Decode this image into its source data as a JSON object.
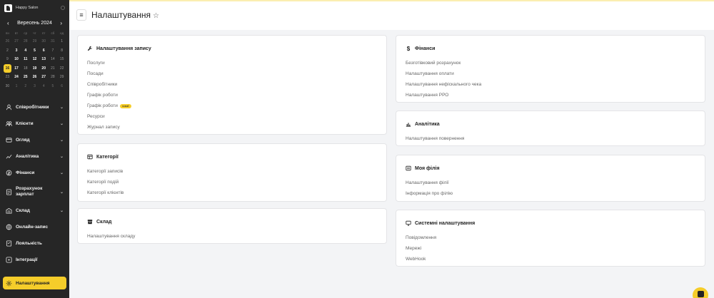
{
  "app": {
    "name": "Happy Salon"
  },
  "calendar": {
    "month": "Вересень 2024",
    "weekdays": [
      "пн",
      "вт",
      "ср",
      "чт",
      "пт",
      "сб",
      "нд"
    ],
    "rows": [
      [
        {
          "d": "26",
          "m": 1
        },
        {
          "d": "27",
          "m": 1
        },
        {
          "d": "28",
          "m": 1
        },
        {
          "d": "29",
          "m": 1
        },
        {
          "d": "30",
          "m": 1
        },
        {
          "d": "31",
          "m": 1
        },
        {
          "d": "1",
          "w": 1
        }
      ],
      [
        {
          "d": "2",
          "w": 1
        },
        {
          "d": "3"
        },
        {
          "d": "4"
        },
        {
          "d": "5"
        },
        {
          "d": "6"
        },
        {
          "d": "7",
          "w": 1
        },
        {
          "d": "8",
          "w": 1
        }
      ],
      [
        {
          "d": "9",
          "w": 1
        },
        {
          "d": "10"
        },
        {
          "d": "11"
        },
        {
          "d": "12"
        },
        {
          "d": "13"
        },
        {
          "d": "14",
          "w": 1
        },
        {
          "d": "15",
          "w": 1
        }
      ],
      [
        {
          "d": "16",
          "t": 1
        },
        {
          "d": "17"
        },
        {
          "d": "18",
          "w": 1
        },
        {
          "d": "19"
        },
        {
          "d": "20"
        },
        {
          "d": "21",
          "w": 1
        },
        {
          "d": "22",
          "w": 1
        }
      ],
      [
        {
          "d": "23",
          "w": 1
        },
        {
          "d": "24"
        },
        {
          "d": "25"
        },
        {
          "d": "26"
        },
        {
          "d": "27"
        },
        {
          "d": "28",
          "w": 1
        },
        {
          "d": "29",
          "w": 1
        }
      ],
      [
        {
          "d": "30",
          "w": 1
        },
        {
          "d": "1",
          "m": 1
        },
        {
          "d": "2",
          "m": 1
        },
        {
          "d": "3",
          "m": 1
        },
        {
          "d": "4",
          "m": 1
        },
        {
          "d": "5",
          "m": 1
        },
        {
          "d": "6",
          "m": 1
        }
      ]
    ]
  },
  "sidebar": {
    "items": [
      {
        "label": "Співробітники",
        "icon": "users-icon"
      },
      {
        "label": "Клієнти",
        "icon": "clients-icon"
      },
      {
        "label": "Огляд",
        "icon": "overview-icon"
      },
      {
        "label": "Аналітика",
        "icon": "analytics-icon"
      },
      {
        "label": "Фінанси",
        "icon": "finance-icon"
      },
      {
        "label": "Розрахунок зарплат",
        "icon": "payroll-icon"
      },
      {
        "label": "Склад",
        "icon": "warehouse-icon"
      },
      {
        "label": "Онлайн-запис",
        "icon": "online-booking-icon"
      },
      {
        "label": "Лояльність",
        "icon": "loyalty-icon"
      },
      {
        "label": "Інтеграції",
        "icon": "integrations-icon"
      },
      {
        "label": "Налаштування",
        "icon": "settings-icon"
      }
    ]
  },
  "header": {
    "title": "Налаштування"
  },
  "cards": {
    "booking": {
      "title": "Налаштування запису",
      "links": [
        "Послуги",
        "Посади",
        "Співробітники",
        "Графік роботи",
        "Графік роботи",
        "Ресурси",
        "Журнал запису"
      ],
      "badge": "новий"
    },
    "categories": {
      "title": "Категорії",
      "links": [
        "Категорії записів",
        "Категорії подій",
        "Категорії клієнтів"
      ]
    },
    "warehouse": {
      "title": "Склад",
      "links": [
        "Налаштування складу"
      ]
    },
    "finance": {
      "title": "Фінанси",
      "links": [
        "Безготівковий розрахунок",
        "Налаштування оплати",
        "Налаштування нефіскального чека",
        "Налаштування РРО"
      ]
    },
    "analytics": {
      "title": "Аналітика",
      "links": [
        "Налаштування повернення"
      ]
    },
    "branch": {
      "title": "Моя філія",
      "links": [
        "Налаштування філії",
        "Інформація про філію"
      ]
    },
    "system": {
      "title": "Системні налаштування",
      "links": [
        "Повідомлення",
        "Мережі",
        "WebHook"
      ]
    }
  },
  "colors": {
    "accent": "#f5cd2a",
    "sidebar_bg": "#262626"
  }
}
